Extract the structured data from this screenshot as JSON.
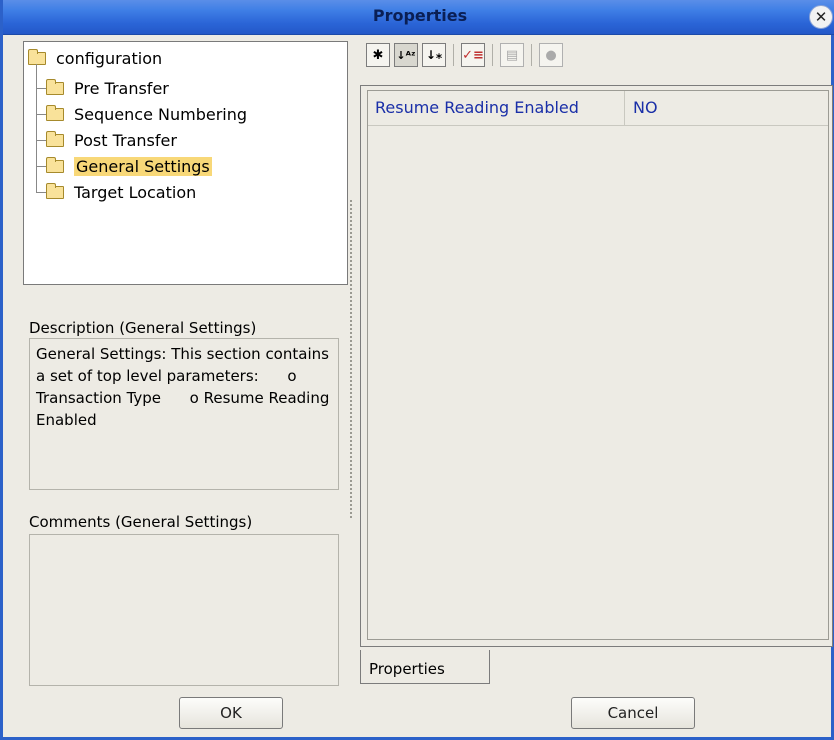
{
  "window": {
    "title": "Properties"
  },
  "tree": {
    "root": "configuration",
    "items": [
      {
        "label": "Pre Transfer",
        "selected": false
      },
      {
        "label": "Sequence Numbering",
        "selected": false
      },
      {
        "label": "Post Transfer",
        "selected": false
      },
      {
        "label": "General Settings",
        "selected": true
      },
      {
        "label": "Target Location",
        "selected": false
      }
    ]
  },
  "description": {
    "label": "Description (General Settings)",
    "text": "General Settings: This section contains a set of top level parameters:      o Transaction Type      o Resume Reading Enabled"
  },
  "comments": {
    "label": "Comments (General Settings)",
    "text": ""
  },
  "toolbar": {
    "buttons": [
      "categorized-icon",
      "sort-alpha-icon",
      "sort-custom-icon",
      "checklist-icon",
      "grid-icon",
      "help-icon"
    ]
  },
  "properties": {
    "rows": [
      {
        "name": "Resume Reading Enabled",
        "value": "NO"
      }
    ],
    "tab_label": "Properties"
  },
  "buttons": {
    "ok": "OK",
    "cancel": "Cancel"
  }
}
